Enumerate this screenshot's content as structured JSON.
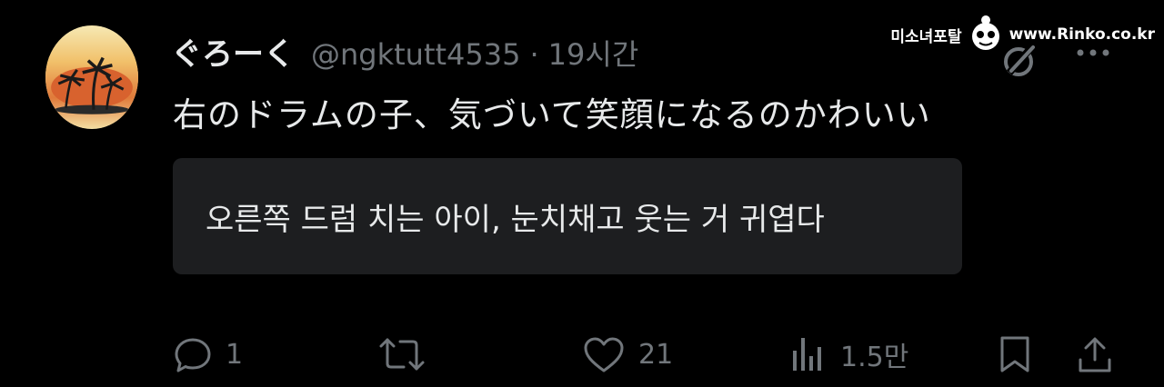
{
  "post": {
    "display_name": "ぐろーく",
    "handle": "@ngktutt4535",
    "separator": "·",
    "time": "19시간",
    "text": "右のドラムの子、気づいて笑顔になるのかわいい",
    "translation": "오른쪽 드럼 치는 아이, 눈치채고 웃는 거 귀엽다"
  },
  "actions": {
    "reply_count": "1",
    "repost_count": "",
    "like_count": "21",
    "view_count": "1.5만"
  },
  "watermark": {
    "left_text": "미소녀포탈",
    "right_text": "www.Rinko.co.kr"
  },
  "icons": {
    "avatar": "palm-trees-sunset-avatar",
    "grok": "grok-icon",
    "more": "more-dots-icon",
    "reply": "reply-icon",
    "repost": "repost-icon",
    "like": "heart-icon",
    "views": "views-chart-icon",
    "bookmark": "bookmark-icon",
    "share": "share-icon"
  },
  "colors": {
    "background": "#000000",
    "text": "#e7e9ea",
    "secondary": "#71767b",
    "translation_box": "#1d1e20"
  }
}
